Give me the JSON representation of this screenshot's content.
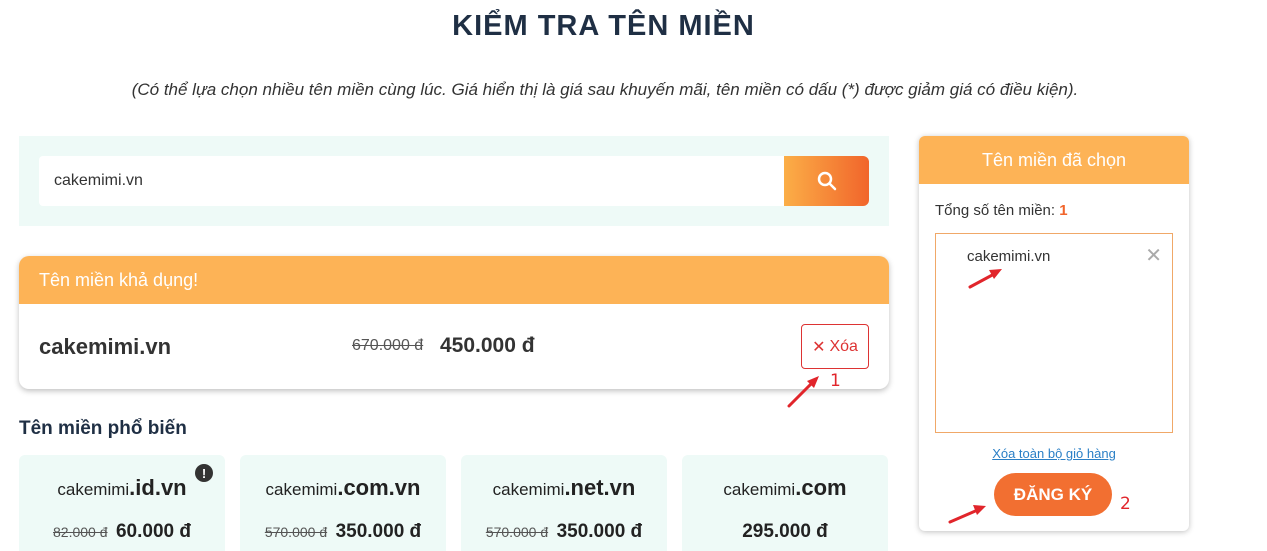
{
  "page": {
    "title": "KIỂM TRA TÊN MIỀN",
    "subtitle": "(Có thể lựa chọn nhiều tên miền cùng lúc. Giá hiển thị là giá sau khuyến mãi, tên miền có dấu (*) được giảm giá có điều kiện)."
  },
  "search": {
    "value": "cakemimi.vn",
    "icon": "search-icon"
  },
  "available": {
    "header": "Tên miền khả dụng!",
    "domain": "cakemimi.vn",
    "old_price": "670.000 đ",
    "new_price": "450.000 đ",
    "remove_label": "Xóa",
    "remove_icon": "close-icon"
  },
  "popular": {
    "title": "Tên miền phổ biến",
    "items": [
      {
        "base": "cakemimi",
        "ext": ".id.vn",
        "old_price": "82.000 đ",
        "new_price": "60.000 đ",
        "info": "!"
      },
      {
        "base": "cakemimi",
        "ext": ".com.vn",
        "old_price": "570.000 đ",
        "new_price": "350.000 đ"
      },
      {
        "base": "cakemimi",
        "ext": ".net.vn",
        "old_price": "570.000 đ",
        "new_price": "350.000 đ"
      },
      {
        "base": "cakemimi",
        "ext": ".com",
        "old_price": "",
        "new_price": "295.000 đ"
      }
    ]
  },
  "cart": {
    "header": "Tên miền đã chọn",
    "total_label": "Tổng số tên miền:",
    "total_count": "1",
    "items": [
      {
        "name": "cakemimi.vn",
        "remove": "✕"
      }
    ],
    "clear_label": "Xóa toàn bộ giỏ hàng",
    "register_label": "ĐĂNG KÝ"
  },
  "annotations": {
    "one": "1",
    "two": "2",
    "color": "#e1252b"
  },
  "colors": {
    "accent": "#fdb356",
    "cta": "#f26f31",
    "panel_bg": "#eefaf7"
  }
}
